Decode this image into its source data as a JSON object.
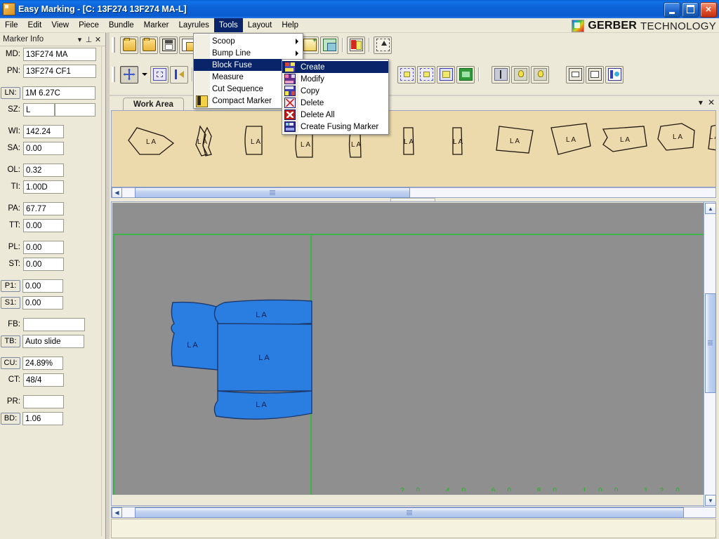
{
  "window": {
    "app_title": "Easy Marking",
    "document_title": "[C: 13F274 13F274 MA-L]",
    "full_title": "Easy Marking - [C: 13F274 13F274 MA-L]",
    "icon": "app-icon",
    "buttons": {
      "minimize": "minimize",
      "maximize": "maximize",
      "close": "close"
    },
    "titlebar_color": "#0a5fd4"
  },
  "brand": {
    "name_bold": "GERBER",
    "name_light": "TECHNOLOGY",
    "logo": "gerber-logo"
  },
  "menubar": {
    "items": [
      {
        "label": "File",
        "open": false
      },
      {
        "label": "Edit",
        "open": false
      },
      {
        "label": "View",
        "open": false
      },
      {
        "label": "Piece",
        "open": false
      },
      {
        "label": "Bundle",
        "open": false
      },
      {
        "label": "Marker",
        "open": false
      },
      {
        "label": "Layrules",
        "open": false
      },
      {
        "label": "Tools",
        "open": true
      },
      {
        "label": "Layout",
        "open": false
      },
      {
        "label": "Help",
        "open": false
      }
    ]
  },
  "tools_menu": {
    "items": [
      {
        "label": "Scoop",
        "submenu": true,
        "highlight": false,
        "icon": ""
      },
      {
        "label": "Bump Line",
        "submenu": true,
        "highlight": false,
        "icon": ""
      },
      {
        "label": "Block Fuse",
        "submenu": true,
        "highlight": true,
        "icon": ""
      },
      {
        "label": "Measure",
        "submenu": true,
        "highlight": false,
        "icon": ""
      },
      {
        "label": "Cut Sequence",
        "submenu": true,
        "highlight": false,
        "icon": ""
      },
      {
        "label": "Compact Marker",
        "submenu": false,
        "highlight": false,
        "icon": "traffic-light-icon"
      }
    ]
  },
  "block_fuse_menu": {
    "items": [
      {
        "label": "Create",
        "highlight": true,
        "icon": "create-icon"
      },
      {
        "label": "Modify",
        "highlight": false,
        "icon": "modify-icon"
      },
      {
        "label": "Copy",
        "highlight": false,
        "icon": "copy-icon"
      },
      {
        "label": "Delete",
        "highlight": false,
        "icon": "delete-icon"
      },
      {
        "label": "Delete All",
        "highlight": false,
        "icon": "delete-all-icon"
      },
      {
        "label": "Create Fusing Marker",
        "highlight": false,
        "icon": "create-fusing-marker-icon"
      }
    ]
  },
  "toolbar": {
    "row1": [
      {
        "icon": "open-marker-icon",
        "framed": true
      },
      {
        "icon": "open-model-icon",
        "framed": true
      },
      {
        "icon": "save-icon",
        "framed": true
      },
      {
        "icon": "save-as-icon",
        "framed": true
      },
      {
        "icon": "new-piece-icon",
        "framed": true
      },
      {
        "icon": "new-multi-icon",
        "framed": true
      },
      {
        "icon": "report-icon",
        "framed": true
      },
      {
        "icon": "export-icon",
        "framed": true
      }
    ],
    "row2": [
      {
        "icon": "move-tool-icon",
        "pressed": true
      },
      {
        "icon": "dropdown-caret-icon",
        "pressed": false
      },
      {
        "icon": "zoom-selection-icon",
        "framed": true
      },
      {
        "icon": "flip-icon",
        "framed": true
      },
      {
        "icon": "fit-piece-icon",
        "framed": true
      },
      {
        "icon": "fit-marker-icon",
        "framed": true
      },
      {
        "icon": "fit-selection-icon",
        "framed": true
      },
      {
        "icon": "fit-width-icon",
        "framed": true
      },
      {
        "icon": "t-pin-icon",
        "framed": true
      },
      {
        "icon": "bulb-on-icon",
        "framed": true
      },
      {
        "icon": "bulb-off-icon",
        "framed": true
      },
      {
        "icon": "window-icon",
        "framed": true
      },
      {
        "icon": "window-shadow-icon",
        "framed": true
      },
      {
        "icon": "properties-icon",
        "framed": true
      }
    ]
  },
  "marker_info_panel": {
    "title": "Marker Info",
    "controls": [
      {
        "icon": "chevron-down-icon"
      },
      {
        "icon": "pin-icon"
      },
      {
        "icon": "close-icon"
      }
    ],
    "groups": [
      {
        "fields": [
          {
            "label": "MD:",
            "value": "13F274 MA",
            "boxed": false,
            "width": "w104"
          },
          {
            "label": "PN:",
            "value": "13F274 CF1",
            "boxed": false,
            "width": "w104"
          }
        ]
      },
      {
        "fields": [
          {
            "label": "LN:",
            "value": "1M 6.27C",
            "boxed": true,
            "width": "w104"
          },
          {
            "label": "SZ:",
            "value": "L",
            "boxed": false,
            "width": "w104",
            "split": true
          }
        ]
      },
      {
        "fields": [
          {
            "label": "WI:",
            "value": "142.24",
            "boxed": false,
            "width": "w60"
          },
          {
            "label": "SA:",
            "value": "0.00",
            "boxed": false,
            "width": "w60"
          }
        ]
      },
      {
        "fields": [
          {
            "label": "OL:",
            "value": "0.32",
            "boxed": false,
            "width": "w60"
          },
          {
            "label": "TI:",
            "value": "1.00D",
            "boxed": false,
            "width": "w60"
          }
        ]
      },
      {
        "fields": [
          {
            "label": "PA:",
            "value": "67.77",
            "boxed": false,
            "width": "w60"
          },
          {
            "label": "TT:",
            "value": "0.00",
            "boxed": false,
            "width": "w60"
          }
        ]
      },
      {
        "fields": [
          {
            "label": "PL:",
            "value": "0.00",
            "boxed": false,
            "width": "w60"
          },
          {
            "label": "ST:",
            "value": "0.00",
            "boxed": false,
            "width": "w60"
          }
        ]
      },
      {
        "fields": [
          {
            "label": "P1:",
            "value": "0.00",
            "boxed": true,
            "width": "w60"
          },
          {
            "label": "S1:",
            "value": "0.00",
            "boxed": true,
            "width": "w60"
          }
        ]
      },
      {
        "fields": [
          {
            "label": "FB:",
            "value": "",
            "boxed": false,
            "width": "w88"
          },
          {
            "label": "TB:",
            "value": "Auto slide",
            "boxed": true,
            "width": "w88"
          }
        ]
      },
      {
        "fields": [
          {
            "label": "CU:",
            "value": "24.89%",
            "boxed": true,
            "width": "w60"
          },
          {
            "label": "CT:",
            "value": "48/4",
            "boxed": false,
            "width": "w60"
          }
        ]
      },
      {
        "fields": [
          {
            "label": "PR:",
            "value": "",
            "boxed": false,
            "width": "w60"
          },
          {
            "label": "BD:",
            "value": "1.06",
            "boxed": true,
            "width": "w60"
          }
        ]
      }
    ]
  },
  "work_area": {
    "tab_label": "Work Area",
    "tab_controls": [
      {
        "icon": "chevron-down-icon"
      },
      {
        "icon": "close-icon"
      }
    ],
    "piece_strip": {
      "background_color": "#ecd9ac",
      "piece_label": "L A",
      "piece_count": 13
    },
    "canvas": {
      "background_color": "#8f8f8f",
      "boundary_color": "#3cb54a",
      "piece_fill": "#2a7de1",
      "piece_stroke": "#1c3a6e",
      "piece_label": "L A",
      "placed_pieces": 4,
      "ruler_labels": "20  40  60  80  100  120"
    }
  }
}
